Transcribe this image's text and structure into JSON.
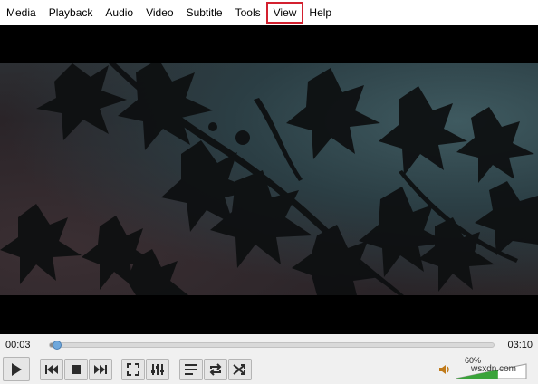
{
  "menu": {
    "items": [
      {
        "label": "Media"
      },
      {
        "label": "Playback"
      },
      {
        "label": "Audio"
      },
      {
        "label": "Video"
      },
      {
        "label": "Subtitle"
      },
      {
        "label": "Tools"
      },
      {
        "label": "View",
        "highlighted": true
      },
      {
        "label": "Help"
      }
    ]
  },
  "player": {
    "elapsed": "00:03",
    "total": "03:10",
    "progress_fraction": 0.016,
    "volume_label": "60%",
    "volume_fraction": 0.6
  },
  "watermark": "wsxdn.com",
  "colors": {
    "highlight_outline": "#d3202f",
    "seek_handle": "#6fa8dc",
    "volume_fill": "#3aa33a"
  },
  "controls": {
    "play": "play-icon",
    "previous": "previous-icon",
    "stop": "stop-icon",
    "next": "next-icon",
    "fullscreen": "fullscreen-icon",
    "extended_settings": "sliders-icon",
    "playlist": "playlist-icon",
    "loop": "loop-icon",
    "random": "shuffle-icon",
    "volume": "speaker-icon"
  }
}
